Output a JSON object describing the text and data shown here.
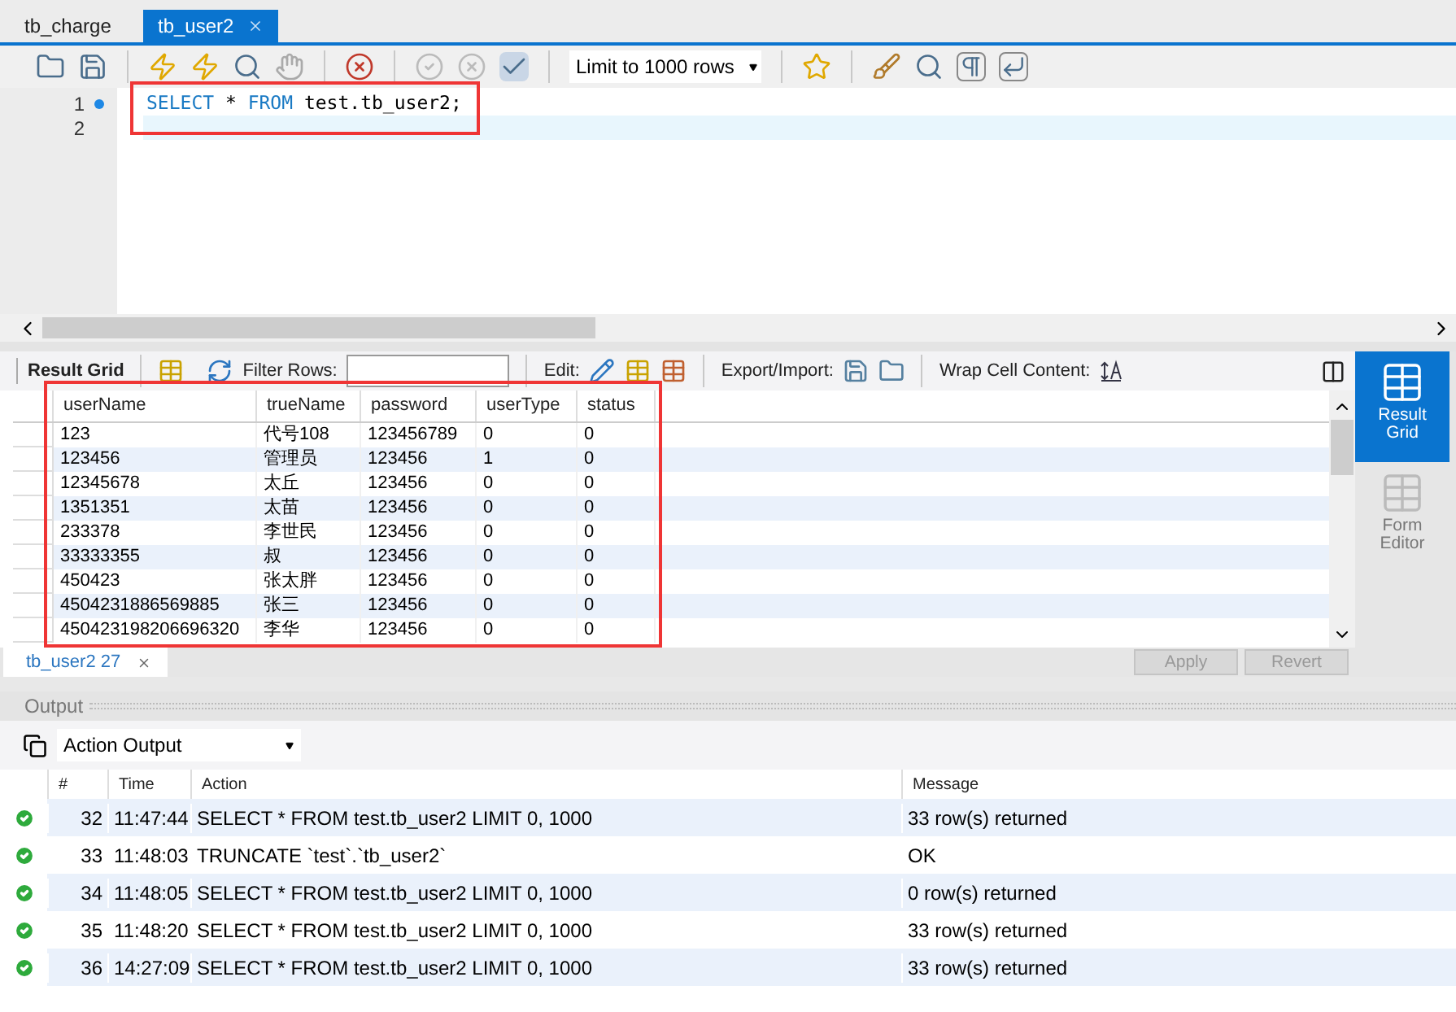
{
  "editor_tabs": [
    {
      "label": "tb_charge",
      "selected": false
    },
    {
      "label": "tb_user2",
      "selected": true
    }
  ],
  "toolbar": {
    "limit_select": "Limit to 1000 rows"
  },
  "editor": {
    "lines": [
      {
        "number": "1",
        "marker": true,
        "tokens": [
          {
            "text": "SELECT",
            "kind": "keyword"
          },
          {
            "text": " * ",
            "kind": "plain"
          },
          {
            "text": "FROM",
            "kind": "keyword"
          },
          {
            "text": " test.tb_user2;",
            "kind": "plain"
          }
        ]
      },
      {
        "number": "2",
        "marker": false
      }
    ]
  },
  "result_toolbar": {
    "result_grid_label": "Result Grid",
    "filter_label": "Filter Rows:",
    "edit_label": "Edit:",
    "export_label": "Export/Import:",
    "wrap_label": "Wrap Cell Content:"
  },
  "result_grid": {
    "columns": [
      "userName",
      "trueName",
      "password",
      "userType",
      "status"
    ],
    "rows": [
      [
        "123",
        "代号108",
        "123456789",
        "0",
        "0"
      ],
      [
        "123456",
        "管理员",
        "123456",
        "1",
        "0"
      ],
      [
        "12345678",
        "太丘",
        "123456",
        "0",
        "0"
      ],
      [
        "1351351",
        "太苗",
        "123456",
        "0",
        "0"
      ],
      [
        "233378",
        "李世民",
        "123456",
        "0",
        "0"
      ],
      [
        "33333355",
        "叔",
        "123456",
        "0",
        "0"
      ],
      [
        "450423",
        "张太胖",
        "123456",
        "0",
        "0"
      ],
      [
        "4504231886569885",
        "张三",
        "123456",
        "0",
        "0"
      ],
      [
        "450423198206696320",
        "李华",
        "123456",
        "0",
        "0"
      ]
    ]
  },
  "side_panel": [
    {
      "label": "Result Grid",
      "selected": true
    },
    {
      "label": "Form Editor",
      "selected": false
    }
  ],
  "result_tab": {
    "label": "tb_user2 27"
  },
  "result_buttons": [
    {
      "label": "Apply",
      "disabled": true
    },
    {
      "label": "Revert",
      "disabled": true
    }
  ],
  "output": {
    "title": "Output",
    "select": "Action Output",
    "columns": [
      "#",
      "Time",
      "Action",
      "Message"
    ],
    "rows": [
      {
        "succeeded": true,
        "number": "32",
        "time": "11:47:44",
        "action": "SELECT * FROM test.tb_user2 LIMIT 0, 1000",
        "message": "33 row(s) returned"
      },
      {
        "succeeded": true,
        "number": "33",
        "time": "11:48:03",
        "action": "TRUNCATE `test`.`tb_user2`",
        "message": "OK"
      },
      {
        "succeeded": true,
        "number": "34",
        "time": "11:48:05",
        "action": "SELECT * FROM test.tb_user2 LIMIT 0, 1000",
        "message": "0 row(s) returned"
      },
      {
        "succeeded": true,
        "number": "35",
        "time": "11:48:20",
        "action": "SELECT * FROM test.tb_user2 LIMIT 0, 1000",
        "message": "33 row(s) returned"
      },
      {
        "succeeded": true,
        "number": "36",
        "time": "14:27:09",
        "action": "SELECT * FROM test.tb_user2 LIMIT 0, 1000",
        "message": "33 row(s) returned"
      }
    ]
  }
}
